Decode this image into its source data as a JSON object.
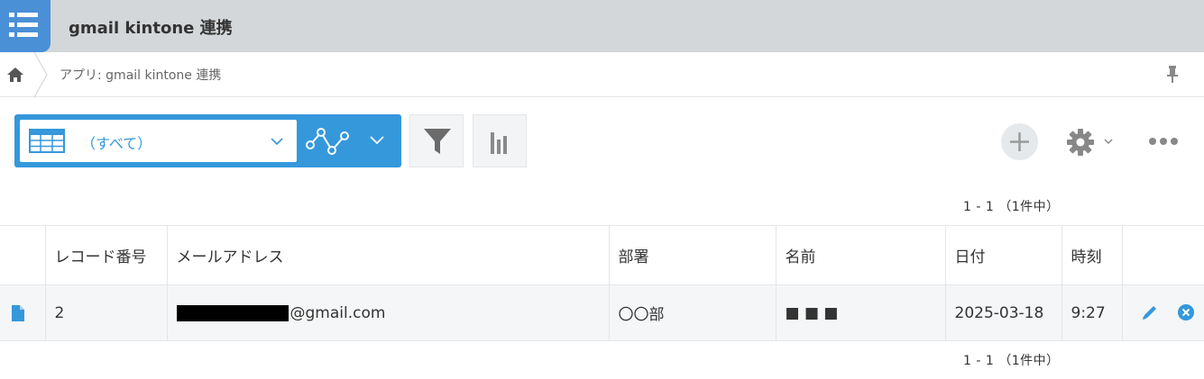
{
  "header": {
    "app_title": "gmail kintone 連携",
    "icon": "app-list-icon"
  },
  "breadcrumb": {
    "home_icon": "home-icon",
    "path": "アプリ: gmail kintone 連携",
    "pin_icon": "pin-icon"
  },
  "toolbar": {
    "view_name": "（すべて）",
    "view_icon": "table-view-icon",
    "graph_icon": "graph-icon",
    "filter_icon": "filter-icon",
    "chart_icon": "bar-chart-icon",
    "add_icon": "plus-icon",
    "settings_icon": "gear-icon",
    "more_icon": "more-icon"
  },
  "pager": {
    "top": "1 - 1 （1件中）",
    "bottom": "1 - 1 （1件中）"
  },
  "table": {
    "columns": [
      "レコード番号",
      "メールアドレス",
      "部署",
      "名前",
      "日付",
      "時刻"
    ],
    "rows": [
      {
        "record_no": "2",
        "email_suffix": "@gmail.com",
        "department": "〇〇部",
        "name": "■ ■ ■",
        "date": "2025-03-18",
        "time": "9:27"
      }
    ]
  },
  "colors": {
    "accent": "#3498db",
    "header_bg": "#d4d7d9",
    "row_bg": "#f5f6f7"
  }
}
